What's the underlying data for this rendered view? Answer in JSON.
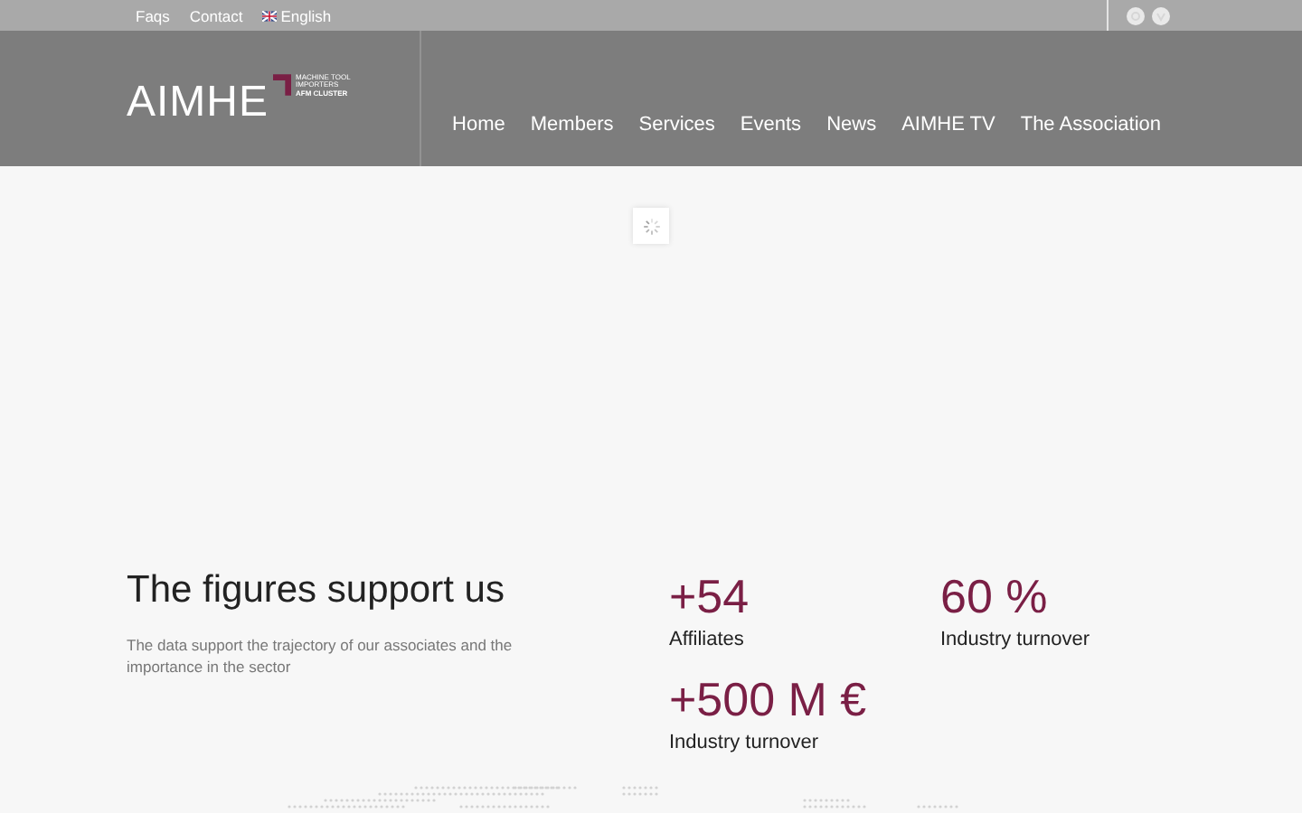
{
  "topbar": {
    "links": [
      "Faqs",
      "Contact"
    ],
    "language": "English"
  },
  "logo": {
    "wordmark": "AIMHE",
    "tagline": [
      "MACHINE TOOL",
      "IMPORTERS",
      "AFM CLUSTER"
    ]
  },
  "nav": [
    {
      "label": "Home"
    },
    {
      "label": "Members"
    },
    {
      "label": "Services"
    },
    {
      "label": "Events"
    },
    {
      "label": "News"
    },
    {
      "label": "AIMHE TV"
    },
    {
      "label": "The Association"
    }
  ],
  "figures": {
    "title": "The figures support us",
    "description": "The data support the trajectory of our associates and the importance in the sector",
    "stats": [
      {
        "value": "+54",
        "label": "Affiliates"
      },
      {
        "value": "60 %",
        "label": "Industry turnover"
      },
      {
        "value": "+500 M €",
        "label": "Industry turnover"
      }
    ]
  }
}
